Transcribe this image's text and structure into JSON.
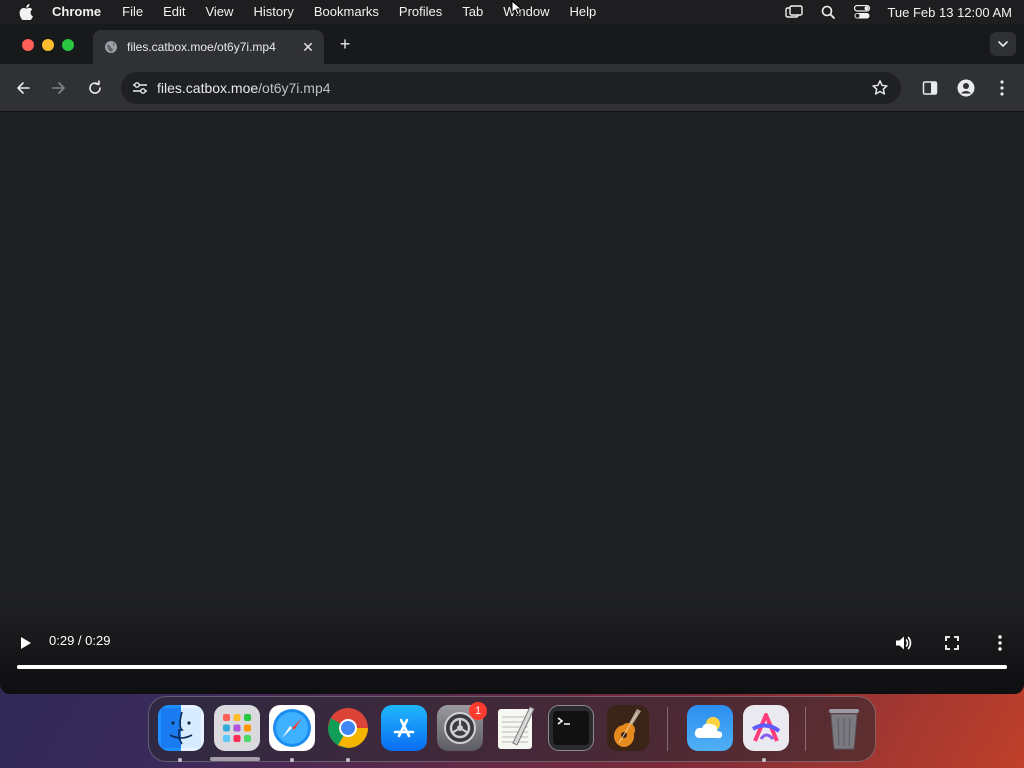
{
  "menubar": {
    "app_name": "Chrome",
    "items": [
      "File",
      "Edit",
      "View",
      "History",
      "Bookmarks",
      "Profiles",
      "Tab",
      "Window",
      "Help"
    ],
    "clock": "Tue Feb 13  12:00 AM"
  },
  "browser": {
    "tab": {
      "title": "files.catbox.moe/ot6y7i.mp4",
      "favicon": "globe-icon"
    },
    "address": {
      "host": "files.catbox.moe",
      "path": "/ot6y7i.mp4"
    }
  },
  "video": {
    "timecode": "0:29 / 0:29",
    "progress_fraction": 1.0
  },
  "dock": {
    "apps": [
      "Finder",
      "Launchpad",
      "Safari",
      "Google Chrome",
      "App Store",
      "System Settings",
      "TextEdit",
      "Terminal",
      "GarageBand",
      "Weather",
      "Creativit"
    ],
    "system_settings_badge": "1"
  },
  "colors": {
    "menubar_bg": "#1e1e20",
    "window_bg": "#202124",
    "toolbar_bg": "#303134",
    "close": "#fe5f57",
    "minimize": "#febc2e",
    "zoom": "#28c840",
    "badge": "#ff3b30"
  }
}
